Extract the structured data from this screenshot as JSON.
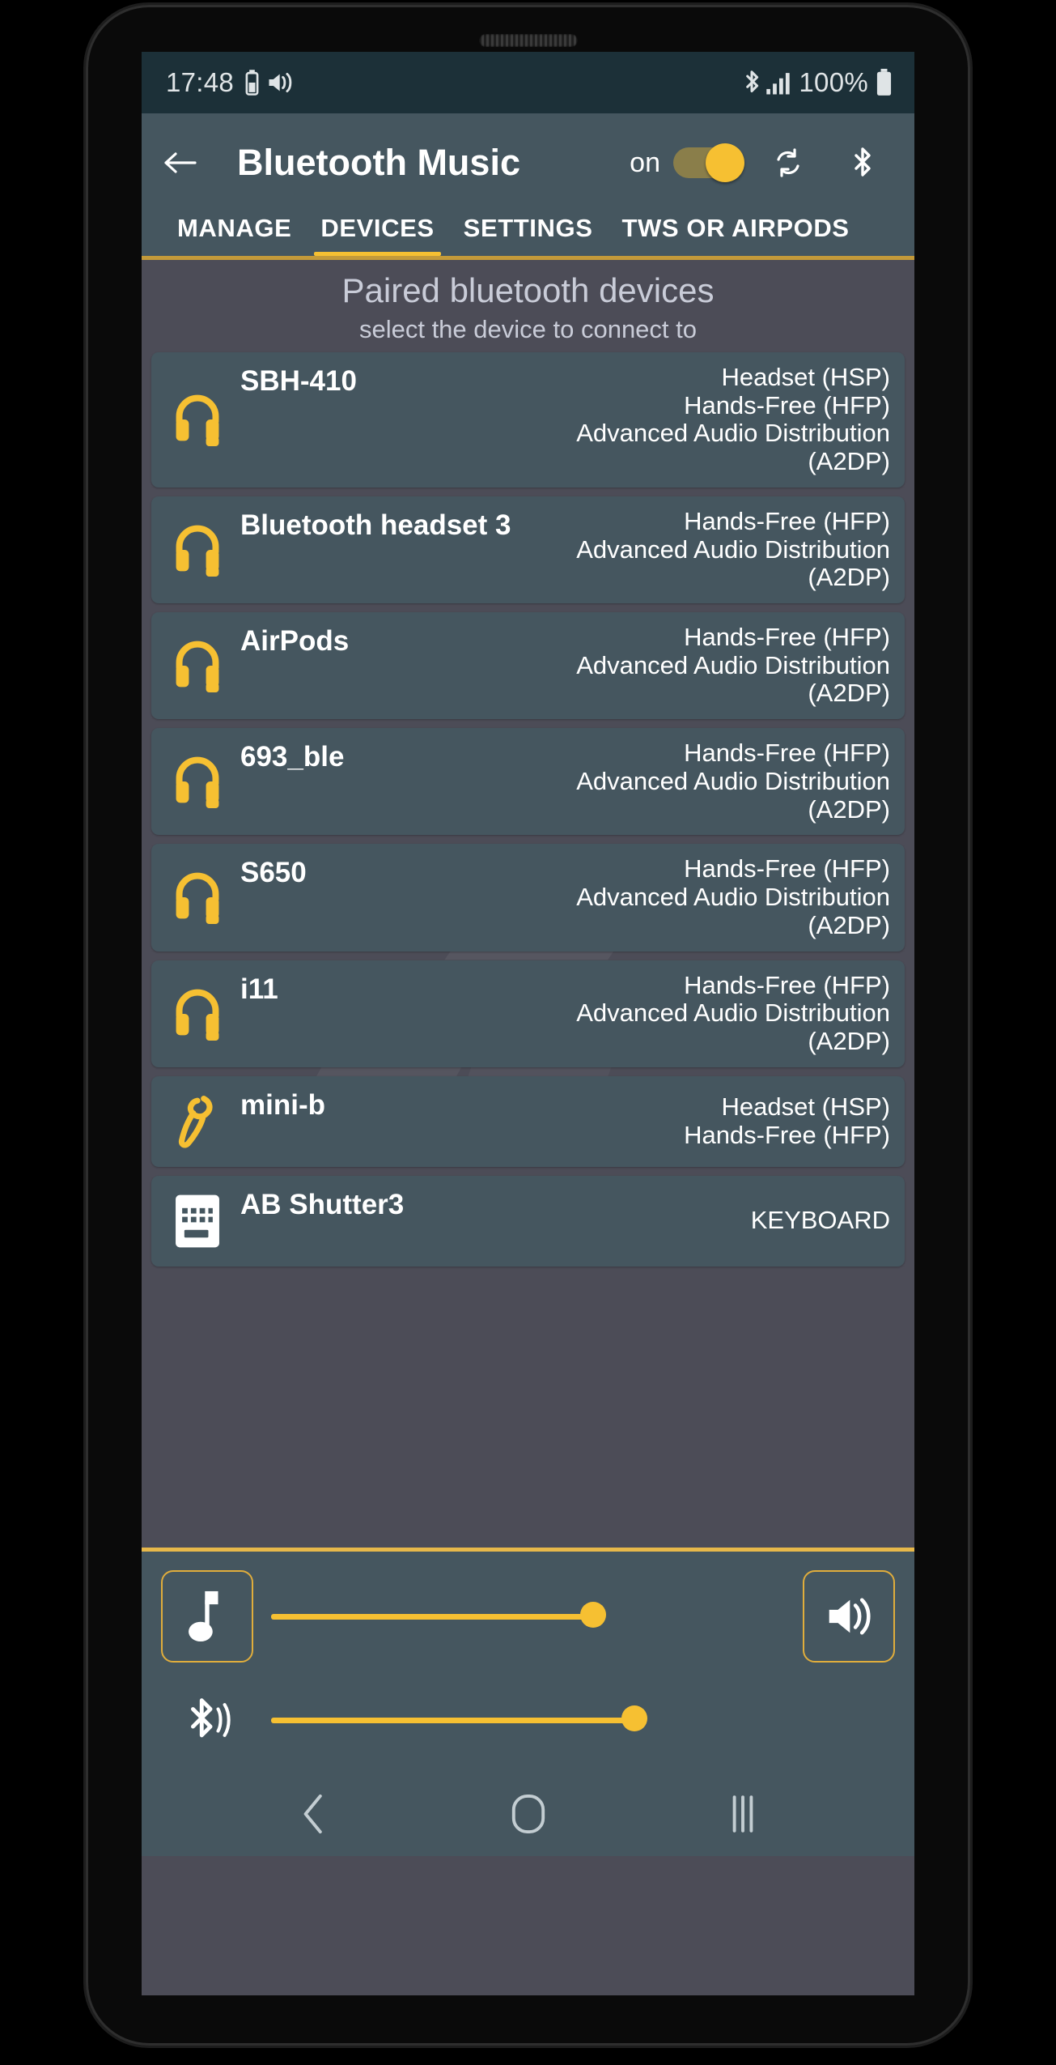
{
  "status_bar": {
    "time": "17:48",
    "battery_text": "100%",
    "icons": [
      "battery-small-icon",
      "volume-icon",
      "bluetooth-icon",
      "signal-bars-icon",
      "battery-icon"
    ]
  },
  "app_bar": {
    "back_icon": "back-arrow-icon",
    "title": "Bluetooth Music",
    "toggle_label": "on",
    "toggle_state": "on",
    "refresh_icon": "refresh-icon",
    "bluetooth_icon": "bluetooth-icon"
  },
  "tabs": [
    {
      "label": "MANAGE",
      "active": false
    },
    {
      "label": "DEVICES",
      "active": true
    },
    {
      "label": "SETTINGS",
      "active": false
    },
    {
      "label": "TWS OR AIRPODS",
      "active": false
    }
  ],
  "list_header": {
    "title": "Paired bluetooth devices",
    "subtitle": "select the device to connect to"
  },
  "devices": [
    {
      "name": "SBH-410",
      "icon": "headset-icon",
      "profiles": [
        "Headset (HSP)",
        "Hands-Free (HFP)",
        "Advanced Audio Distribution",
        "(A2DP)"
      ]
    },
    {
      "name": "Bluetooth headset 3",
      "icon": "headset-icon",
      "profiles": [
        "Hands-Free (HFP)",
        "Advanced Audio Distribution",
        "(A2DP)"
      ]
    },
    {
      "name": "AirPods",
      "icon": "headset-icon",
      "profiles": [
        "Hands-Free (HFP)",
        "Advanced Audio Distribution",
        "(A2DP)"
      ]
    },
    {
      "name": "693_ble",
      "icon": "headset-icon",
      "profiles": [
        "Hands-Free (HFP)",
        "Advanced Audio Distribution",
        "(A2DP)"
      ]
    },
    {
      "name": "S650",
      "icon": "headset-icon",
      "profiles": [
        "Hands-Free (HFP)",
        "Advanced Audio Distribution",
        "(A2DP)"
      ]
    },
    {
      "name": "i11",
      "icon": "headset-icon",
      "profiles": [
        "Hands-Free (HFP)",
        "Advanced Audio Distribution",
        "(A2DP)"
      ]
    },
    {
      "name": "mini-b",
      "icon": "earpiece-icon",
      "profiles": [
        "Headset (HSP)",
        "Hands-Free (HFP)"
      ]
    },
    {
      "name": "AB Shutter3",
      "icon": "keyboard-icon",
      "profiles": [
        "KEYBOARD"
      ]
    }
  ],
  "controls": {
    "music_button_icon": "music-note-icon",
    "music_slider_percent": 62,
    "speaker_button_icon": "speaker-icon",
    "bluetooth_audio_icon": "bluetooth-audio-icon",
    "bluetooth_slider_percent": 70
  },
  "nav_bar": {
    "back": "nav-back-icon",
    "home": "nav-home-icon",
    "recents": "nav-recents-icon"
  },
  "colors": {
    "status_bar_bg": "#1c3038",
    "app_bar_bg": "#45536?",
    "accent": "#f6c032",
    "card_bg": "#45565f",
    "page_bg": "#4c4c57"
  }
}
